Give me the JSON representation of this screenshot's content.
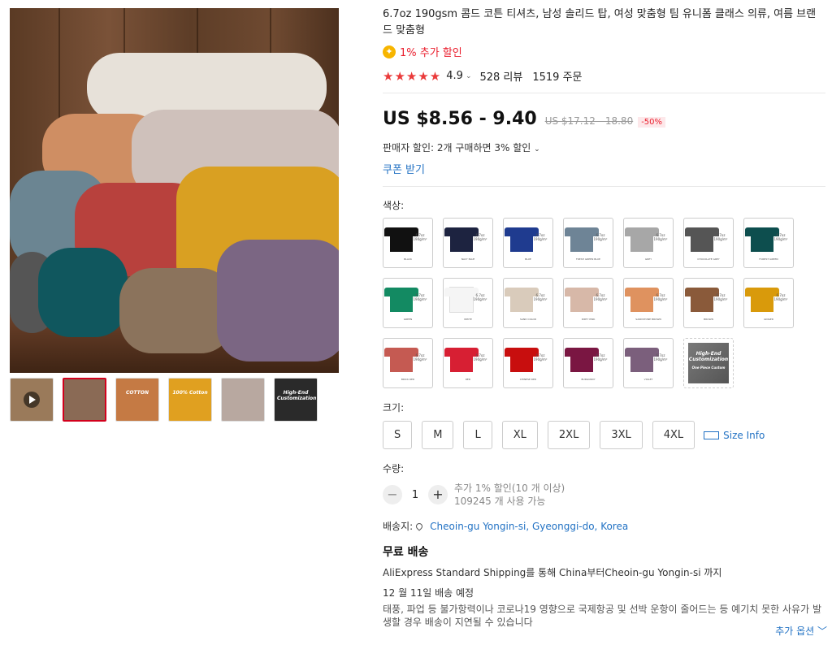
{
  "product": {
    "title": "6.7oz 190gsm 콤드 코튼 티셔츠, 남성 솔리드 탑, 여성 맞춤형 팀 유니폼 클래스 의류, 여름 브랜드 맞춤형",
    "coin_discount": "1% 추가 할인",
    "coin_icon": "coin-icon",
    "stars": "★★★★★",
    "rating": "4.9",
    "reviews": "528 리뷰",
    "orders": "1519 주문",
    "price": "US $8.56 - 9.40",
    "original_price": "US $17.12 - 18.80",
    "discount": "-50%",
    "seller_discount": "판매자 할인: 2개 구매하면 3% 할인",
    "coupon": "쿠폰 받기"
  },
  "variants": {
    "color_label": "색상:",
    "colors": [
      {
        "name": "BLACK",
        "hex": "#111111"
      },
      {
        "name": "NAVY BLUE",
        "hex": "#1d2340"
      },
      {
        "name": "BLUE",
        "hex": "#1f3b8f"
      },
      {
        "name": "FRESH GREEN BLUE",
        "hex": "#6e8496"
      },
      {
        "name": "GREY",
        "hex": "#a7a7a7"
      },
      {
        "name": "CHOCOLATE GREY",
        "hex": "#555555"
      },
      {
        "name": "FOREST GREEN",
        "hex": "#0d4e4e"
      },
      {
        "name": "GREEN",
        "hex": "#138a62"
      },
      {
        "name": "WHITE",
        "hex": "#f5f5f5"
      },
      {
        "name": "SAND COLOR",
        "hex": "#d9cbbb"
      },
      {
        "name": "DIRTY PINK",
        "hex": "#d7b8a8"
      },
      {
        "name": "SANDSTONE BROWN",
        "hex": "#df925f"
      },
      {
        "name": "BROWN",
        "hex": "#8a5a3a"
      },
      {
        "name": "GINGER",
        "hex": "#d99a0b"
      },
      {
        "name": "BRICK RED",
        "hex": "#c55a52"
      },
      {
        "name": "RED",
        "hex": "#d71f33"
      },
      {
        "name": "CHINESE RED",
        "hex": "#c80e0e"
      },
      {
        "name": "BURGUNDY",
        "hex": "#7a1642"
      },
      {
        "name": "VIOLET",
        "hex": "#7b5f7c"
      }
    ],
    "tee_label": "6.7oz 190g/m²",
    "custom_label": "High-End Customization",
    "custom_sub": "One Piece Custom",
    "size_label": "크기:",
    "sizes": [
      "S",
      "M",
      "L",
      "XL",
      "2XL",
      "3XL",
      "4XL"
    ],
    "size_info": "Size Info",
    "qty_label": "수량:",
    "qty": "1",
    "qty_minus": "−",
    "qty_plus": "+",
    "qty_note1": "추가 1% 할인(10 개 이상)",
    "qty_note2": "109245 개 사용 가능"
  },
  "shipping": {
    "to_label": "배송지:",
    "location": "Cheoin-gu Yongin-si, Gyeonggi-do, Korea",
    "free": "무료 배송",
    "method": "AliExpress Standard Shipping를 통해 China부터Cheoin-gu Yongin-si 까지",
    "eta": "12 월 11일 배송 예정",
    "note": "태풍, 파업 등 불가항력이나 코로나19 영향으로 국제항공 및 선박 운항이 줄어드는 등 예기치 못한 사유가 발생할 경우 배송이 지연될 수 있습니다",
    "more": "추가 옵션 ﹀"
  },
  "gallery": {
    "thumbs": [
      {
        "kind": "video",
        "bg": "#9a7a5a"
      },
      {
        "kind": "image",
        "bg": "#8a6a55"
      },
      {
        "kind": "image",
        "bg": "#c57a44",
        "label": "COTTON"
      },
      {
        "kind": "image",
        "bg": "#e0a020",
        "label": "100% Cotton"
      },
      {
        "kind": "image",
        "bg": "#b8a8a0"
      },
      {
        "kind": "image",
        "bg": "#2a2a2a",
        "label": "High-End Customization"
      }
    ]
  }
}
